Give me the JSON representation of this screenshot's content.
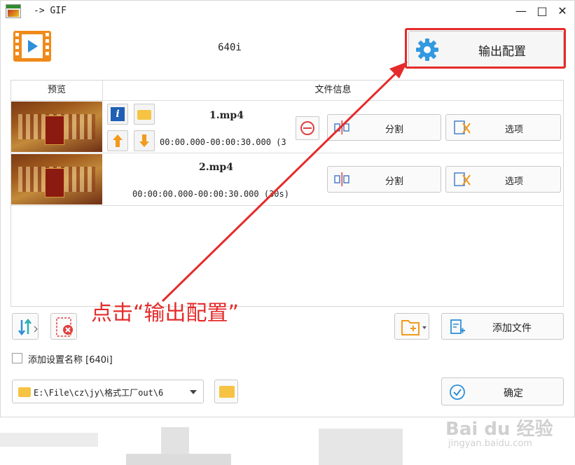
{
  "window": {
    "title": "-> GIF"
  },
  "header": {
    "profile": "640i",
    "output_settings_label": "输出配置"
  },
  "list": {
    "col_preview": "预览",
    "col_info": "文件信息",
    "rows": [
      {
        "name": "1.mp4",
        "time": "00:00.000-00:00:30.000 (3",
        "split_label": "分割",
        "options_label": "选项"
      },
      {
        "name": "2.mp4",
        "time": "00:00:00.000-00:00:30.000 (30s)",
        "split_label": "分割",
        "options_label": "选项"
      }
    ]
  },
  "annotation": "点击“输出配置”",
  "toolbar": {
    "add_file_label": "添加文件"
  },
  "footer": {
    "add_setting_name_label": "添加设置名称 [640i]",
    "output_path": "E:\\File\\cz\\jy\\格式工厂out\\6",
    "ok_label": "确定"
  },
  "watermark": {
    "main": "Bai du 经验",
    "sub": "jingyan.baidu.com"
  },
  "colors": {
    "annotation_red": "#e52b2b",
    "accent_blue": "#2f8fd8",
    "arrow_orange": "#f29a1c",
    "folder_yellow": "#f6c343"
  }
}
